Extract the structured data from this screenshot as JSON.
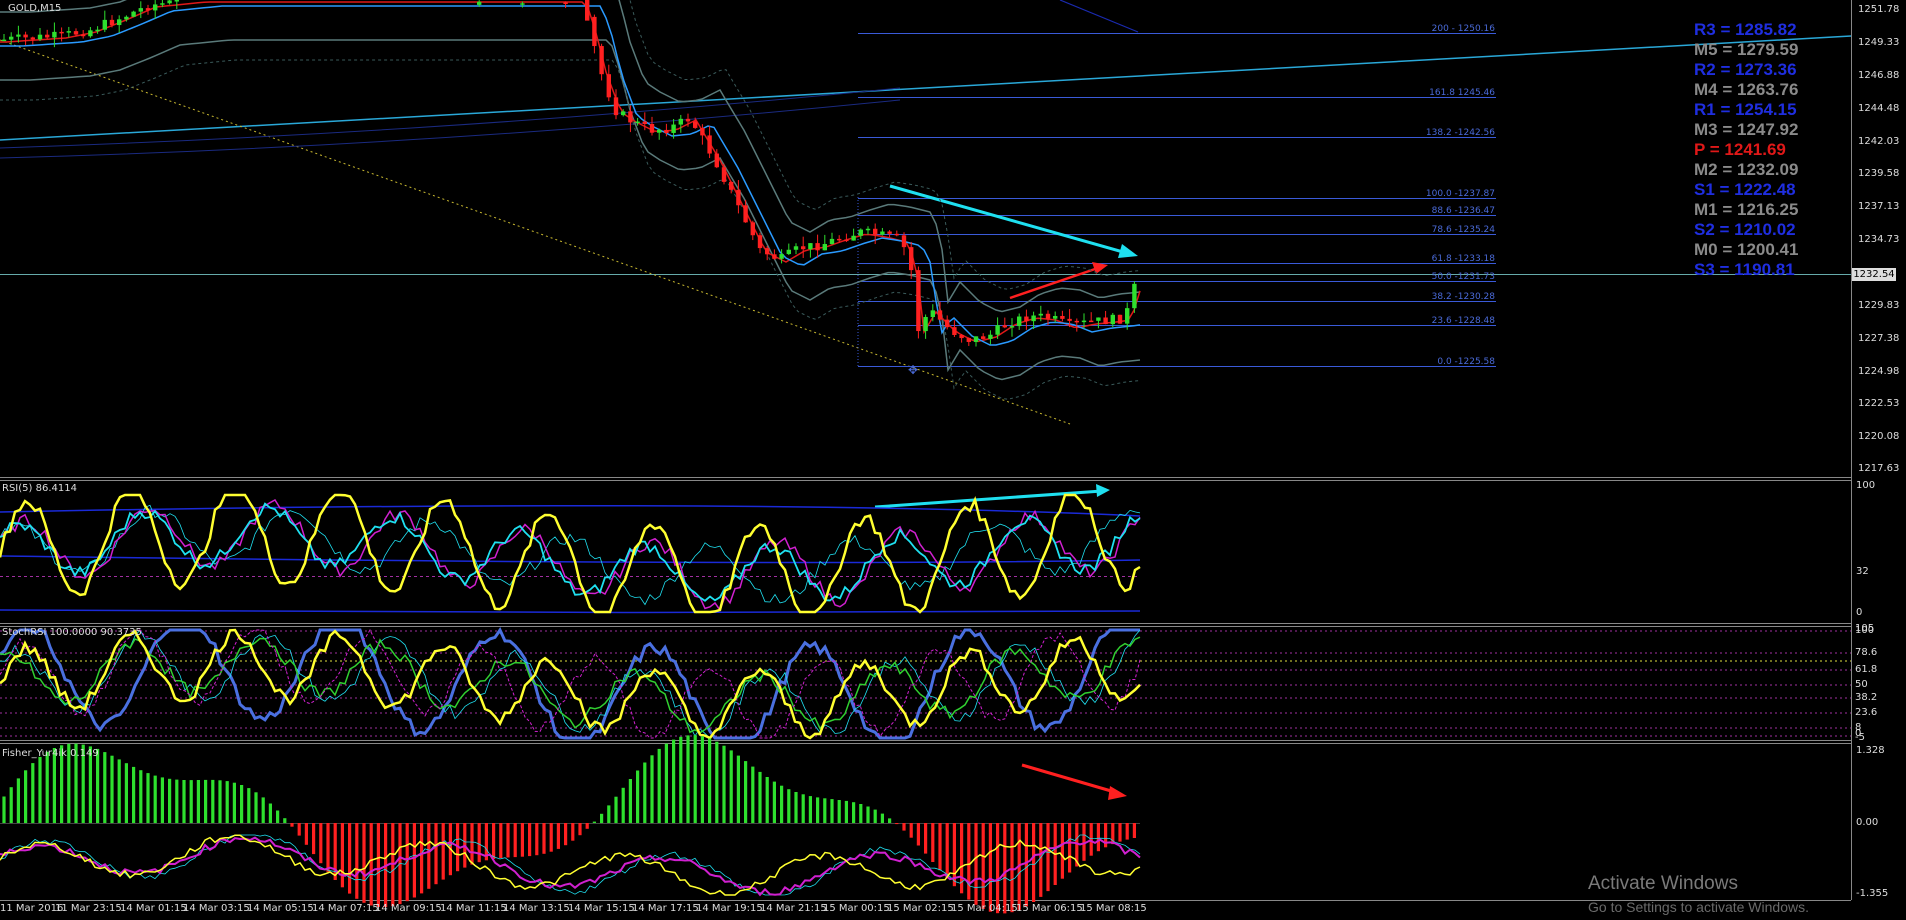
{
  "symbol": "GOLD,M15",
  "current_price": "1232.54",
  "panes": {
    "rsi_title": "RSI(5) 86.4114",
    "stoch_title": "StochRSI 100.0000 90.3735",
    "fisher_title": "Fisher_Yur4ik 0.149"
  },
  "price_scale": [
    "1251.78",
    "1249.33",
    "1246.88",
    "1244.48",
    "1242.03",
    "1239.58",
    "1237.13",
    "1234.73",
    "1232.54",
    "1229.83",
    "1227.38",
    "1224.98",
    "1222.53",
    "1220.08",
    "1217.63"
  ],
  "rsi_scale": [
    "100",
    "32",
    "0"
  ],
  "stoch_scale": [
    "105",
    "100",
    "78.6",
    "61.8",
    "50",
    "38.2",
    "23.6",
    "8",
    "0",
    "-5"
  ],
  "fisher_scale": [
    "1.328",
    "0.00",
    "-1.355"
  ],
  "time_axis": [
    "11 Mar 2016",
    "11 Mar 23:15",
    "14 Mar 01:15",
    "14 Mar 03:15",
    "14 Mar 05:15",
    "14 Mar 07:15",
    "14 Mar 09:15",
    "14 Mar 11:15",
    "14 Mar 13:15",
    "14 Mar 15:15",
    "14 Mar 17:15",
    "14 Mar 19:15",
    "14 Mar 21:15",
    "15 Mar 00:15",
    "15 Mar 02:15",
    "15 Mar 04:15",
    "15 Mar 06:15",
    "15 Mar 08:15"
  ],
  "fib_levels": [
    "200 - 1250.16",
    "161.8 1245.46",
    "138.2 -1242.56",
    "100.0 -1237.87",
    "88.6 -1236.47",
    "78.6 -1235.24",
    "61.8 -1233.18",
    "50.0 -1231.73",
    "38.2 -1230.28",
    "23.6 -1228.48",
    "0.0 -1225.58"
  ],
  "pivots": [
    {
      "text": "R3 = 1285.82",
      "color": "#1f2ee0"
    },
    {
      "text": "M5 = 1279.59",
      "color": "#8a8a8a"
    },
    {
      "text": "R2 = 1273.36",
      "color": "#1f2ee0"
    },
    {
      "text": "M4 = 1263.76",
      "color": "#8a8a8a"
    },
    {
      "text": "R1 = 1254.15",
      "color": "#1f2ee0"
    },
    {
      "text": "M3 = 1247.92",
      "color": "#8a8a8a"
    },
    {
      "text": "P  = 1241.69",
      "color": "#e01818"
    },
    {
      "text": "M2 = 1232.09",
      "color": "#8a8a8a"
    },
    {
      "text": "S1 = 1222.48",
      "color": "#1f2ee0"
    },
    {
      "text": "M1 = 1216.25",
      "color": "#8a8a8a"
    },
    {
      "text": "S2 = 1210.02",
      "color": "#1f2ee0"
    },
    {
      "text": "M0 = 1200.41",
      "color": "#8a8a8a"
    },
    {
      "text": "S3 = 1190.81",
      "color": "#1f2ee0"
    }
  ],
  "watermark": {
    "line1": "Activate Windows",
    "line2": "Go to Settings to activate Windows."
  },
  "colors": {
    "bull": "#2ee02e",
    "bear": "#ff2020",
    "fib": "#3a5ad8",
    "cyan_arrow": "#1fe0f0",
    "red_arrow": "#ff2020"
  }
}
